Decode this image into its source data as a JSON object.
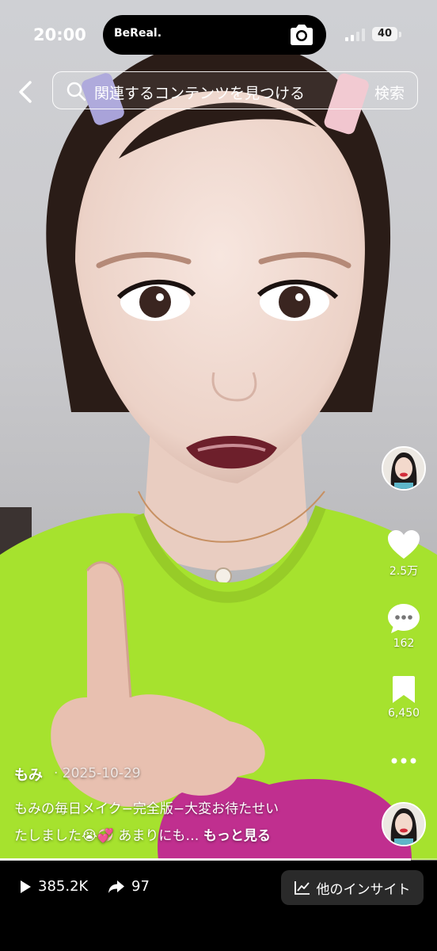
{
  "status_bar": {
    "time": "20:00",
    "island_app": "BeReal.",
    "battery": "40"
  },
  "search": {
    "placeholder": "関連するコンテンツを見つける",
    "button": "検索"
  },
  "rail": {
    "likes": "2.5万",
    "comments": "162",
    "saves": "6,450",
    "more_icon": "more-dots-icon"
  },
  "post": {
    "author": "もみ",
    "date": "· 2025-10-29",
    "caption_line1": "もみの毎日メイク−完全版−大変お待たせい",
    "caption_line2": "たしました😭💞 あまりにも… ",
    "more_label": "もっと見る"
  },
  "progress": 0.94,
  "bottom_bar": {
    "views": "385.2K",
    "shares": "97",
    "insights_label": "他のインサイト"
  },
  "colors": {
    "shirt": "#a6e22e",
    "pink": "#c02f8f",
    "skin": "#f1dbd2",
    "hair": "#2a1c17"
  }
}
